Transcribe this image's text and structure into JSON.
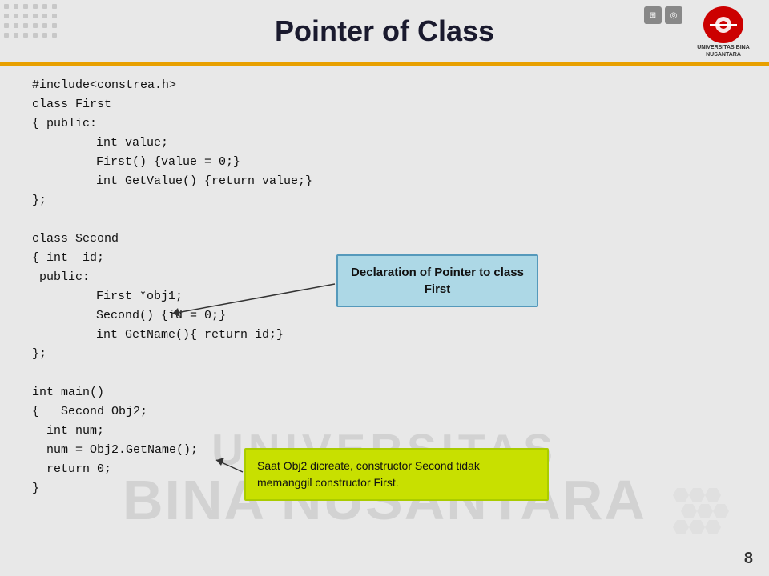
{
  "page": {
    "title": "Pointer of Class",
    "page_number": "8"
  },
  "code": {
    "lines": [
      "#include<constrea.h>",
      "class First",
      "{ public:",
      "            int value;",
      "            First() {value = 0;}",
      "            int GetValue() {return value;}",
      "};",
      "",
      "class Second",
      "{ int  id;",
      " public:",
      "            First *obj1;",
      "            Second() {id = 0;}",
      "            int GetName(){ return id;}",
      "};",
      "",
      "int main()",
      "{   Second Obj2;",
      "  int num;",
      "  num = Obj2.GetName();",
      "  return 0;",
      "}"
    ]
  },
  "callouts": {
    "declaration": {
      "text": "Declaration of Pointer to class First"
    },
    "green_note": {
      "text": "Saat Obj2 dicreate, constructor Second tidak memanggil constructor First."
    }
  },
  "logo": {
    "text": "UNIVERSITAS\nBINA NUSANTARA"
  }
}
